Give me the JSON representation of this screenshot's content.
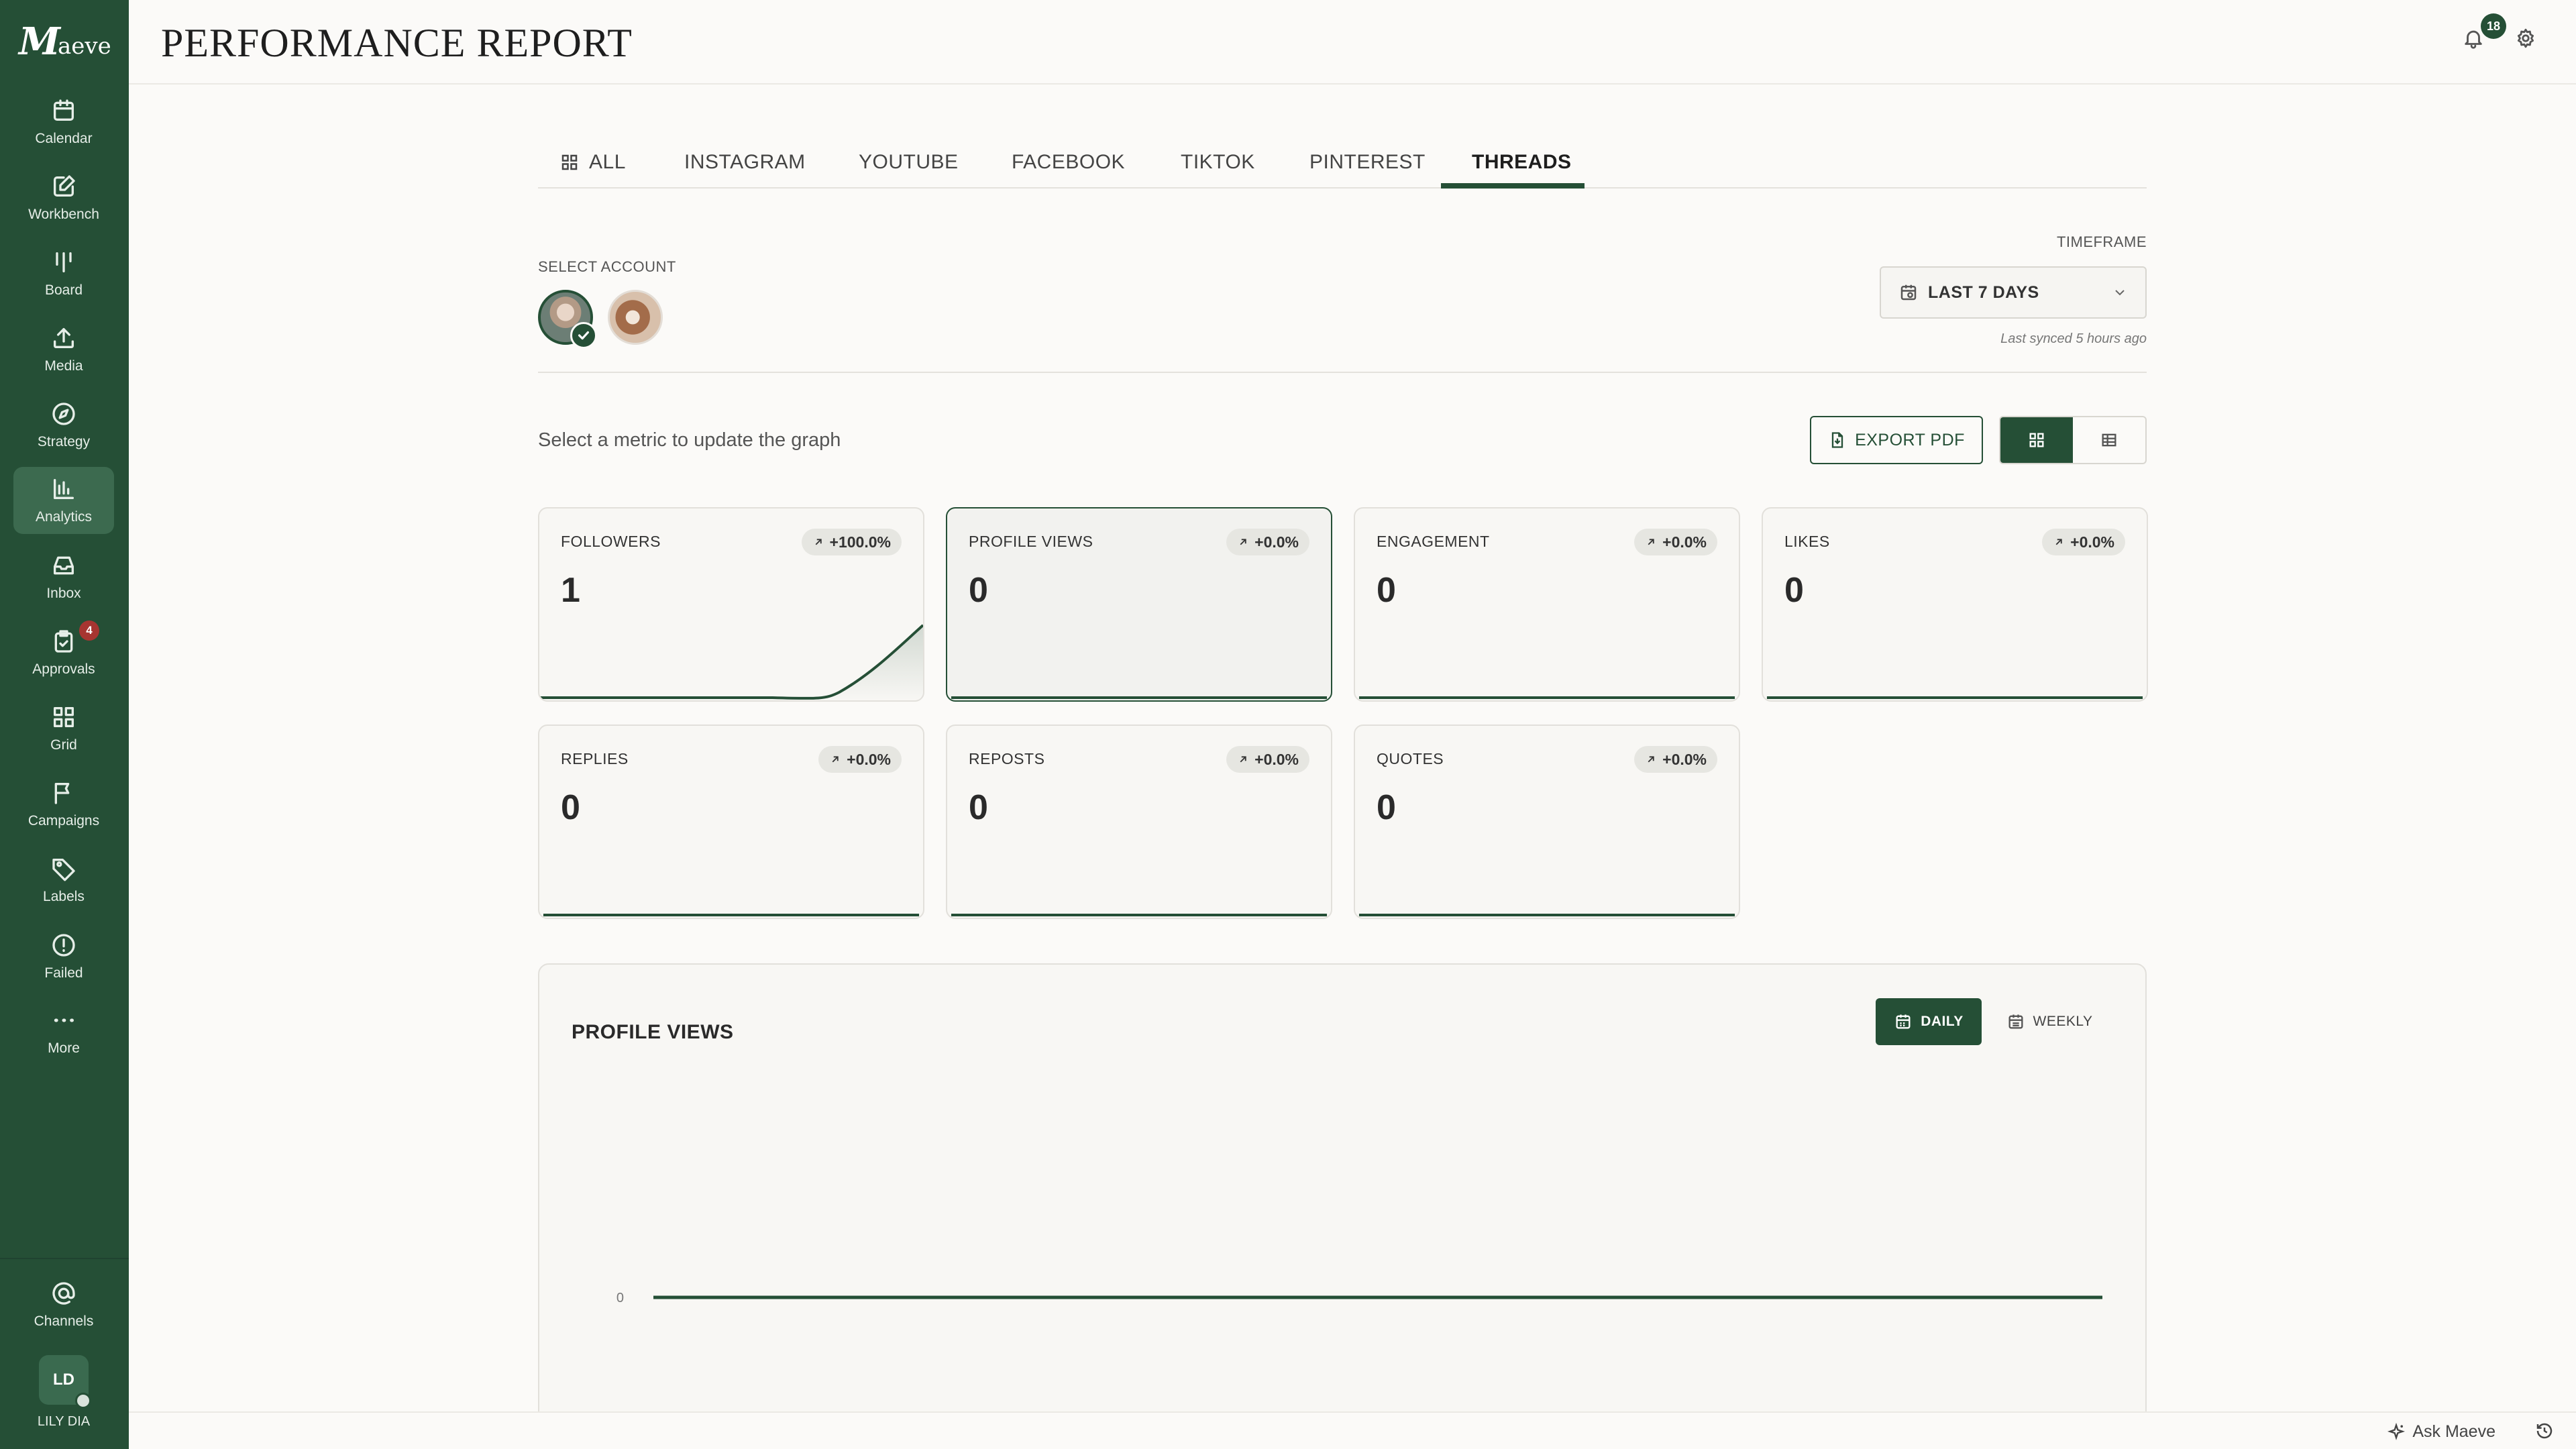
{
  "brand": {
    "logo_mark": "M",
    "logo_rest": "aeve"
  },
  "header": {
    "title": "PERFORMANCE REPORT",
    "notification_count": "18"
  },
  "sidebar": {
    "items": [
      {
        "label": "Calendar",
        "icon": "calendar-icon"
      },
      {
        "label": "Workbench",
        "icon": "edit-icon"
      },
      {
        "label": "Board",
        "icon": "board-icon"
      },
      {
        "label": "Media",
        "icon": "upload-icon"
      },
      {
        "label": "Strategy",
        "icon": "compass-icon"
      },
      {
        "label": "Analytics",
        "icon": "bar-chart-icon",
        "active": true
      },
      {
        "label": "Inbox",
        "icon": "inbox-icon"
      },
      {
        "label": "Approvals",
        "icon": "clipboard-check-icon",
        "badge": "4"
      },
      {
        "label": "Grid",
        "icon": "grid-icon"
      },
      {
        "label": "Campaigns",
        "icon": "flag-icon"
      },
      {
        "label": "Labels",
        "icon": "tag-icon"
      },
      {
        "label": "Failed",
        "icon": "alert-circle-icon"
      },
      {
        "label": "More",
        "icon": "more-horizontal-icon"
      }
    ],
    "channels_label": "Channels",
    "user": {
      "initials": "LD",
      "name": "LILY DIA"
    }
  },
  "tabs": [
    "ALL",
    "INSTAGRAM",
    "YOUTUBE",
    "FACEBOOK",
    "TIKTOK",
    "PINTEREST",
    "THREADS"
  ],
  "active_tab": "THREADS",
  "account": {
    "label": "SELECT ACCOUNT"
  },
  "timeframe": {
    "label": "TIMEFRAME",
    "value": "LAST 7 DAYS",
    "last_synced": "Last synced 5 hours ago"
  },
  "toolbar": {
    "hint": "Select a metric to update the graph",
    "export_label": "EXPORT PDF"
  },
  "metrics": [
    {
      "title": "FOLLOWERS",
      "value": "1",
      "change": "+100.0%"
    },
    {
      "title": "PROFILE VIEWS",
      "value": "0",
      "change": "+0.0%",
      "selected": true
    },
    {
      "title": "ENGAGEMENT",
      "value": "0",
      "change": "+0.0%"
    },
    {
      "title": "LIKES",
      "value": "0",
      "change": "+0.0%"
    },
    {
      "title": "REPLIES",
      "value": "0",
      "change": "+0.0%"
    },
    {
      "title": "REPOSTS",
      "value": "0",
      "change": "+0.0%"
    },
    {
      "title": "QUOTES",
      "value": "0",
      "change": "+0.0%"
    }
  ],
  "chart": {
    "daily_label": "DAILY",
    "weekly_label": "WEEKLY"
  },
  "chart_data": {
    "type": "line",
    "title": "PROFILE VIEWS",
    "y_ticks": [
      "0"
    ],
    "series": [
      {
        "values": [
          0,
          0,
          0,
          0,
          0,
          0,
          0
        ]
      }
    ],
    "ylim": [
      0,
      1
    ],
    "grid": false
  },
  "footer": {
    "ask_label": "Ask Maeve"
  },
  "colors": {
    "primary": "#254f36",
    "badge_red": "#a73531",
    "background": "#fbfaf8"
  }
}
